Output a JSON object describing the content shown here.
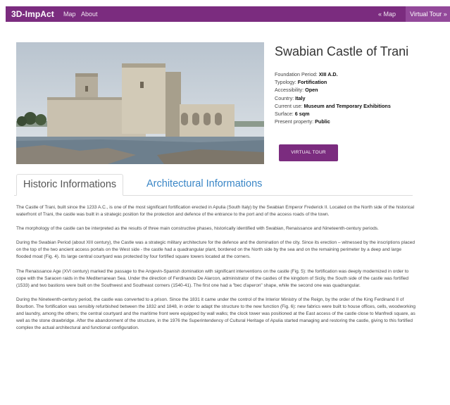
{
  "navbar": {
    "brand": "3D-ImpAct",
    "links": [
      "Map",
      "About"
    ],
    "back_link": "« Map",
    "active_link": "Virtual Tour »"
  },
  "castle": {
    "title": "Swabian Castle of Trani",
    "facts": [
      {
        "label": "Foundation Period: ",
        "value": "XIII A.D."
      },
      {
        "label": "Typology: ",
        "value": "Fortification"
      },
      {
        "label": "Accessibility: ",
        "value": "Open"
      },
      {
        "label": "Country: ",
        "value": "Italy"
      },
      {
        "label": "Current use: ",
        "value": "Museum and Temporary Exhibitions"
      },
      {
        "label": "Surface: ",
        "value": "6 sqm"
      },
      {
        "label": "Present property: ",
        "value": "Public"
      }
    ],
    "tour_button": "VIRTUAL TOUR"
  },
  "tabs": [
    "Historic Informations",
    "Architectural Informations"
  ],
  "paragraphs": [
    "The Castle of Trani, built since the 1233 A.C., is one of the most significant fortification erected in Apulia (South Italy) by the Swabian Emperor Frederick II. Located on the North side of the historical waterfront of Trani, the castle was built in a strategic position for the protection and defence of the entrance to the port and of the access roads of the town.",
    "The morphology of the castle can be interpreted as the results of three main constructive phases, historically identified with Swabian, Renaissance and Nineteenth-century periods.",
    "During the Swabian Period (about XIII century), the Castle was a strategic military architecture for the defence and the domination of the city. Since its erection – witnessed by the inscriptions placed on the top of the two ancient access portals on the West side - the castle had a quadrangular plant, bordered on the North side by the sea and on the remaining perimeter by a deep and large flooded moat (Fig. 4). Its large central courtyard was protected by four fortified square towers located at the corners.",
    "The Renaissance Age (XVI century) marked the passage to the Angevin-Spanish domination with significant interventions on the castle (Fig. 5): the fortification was deeply modernized in order to cope with the Saracen raids in the Mediterranean Sea. Under the direction of Ferdinando De Alarcon, administrator of the castles of the kingdom of Sicily, the South side of the castle was fortified (1533) and two bastions were built on the Southwest and Southeast corners (1540-41). The first one had a \"bec d'aperon\" shape, while the second one was quadrangular.",
    "During the Nineteenth-century period, the castle was converted to a prison. Since the 1831 it came under the control of the Interior Ministry of the Reign, by the order of the King Ferdinand II of Bourbon. The fortification was sensibly refurbished between the 1832 and 1848, in order to adapt the structure to the new function (Fig. 6): new fabrics were built to house offices, cells, woodworking and laundry, among the others; the central courtyard and the maritime front were equipped by wall walks; the clock tower was positioned at the East access of the castle close to Manfredi square, as well as the stone drawbridge. After the abandonment of the structure, in the 1976 the Superintendency of Cultural Heritage of Apulia started managing and restoring the castle, giving to this fortified complex the actual architectural and functional configuration."
  ]
}
